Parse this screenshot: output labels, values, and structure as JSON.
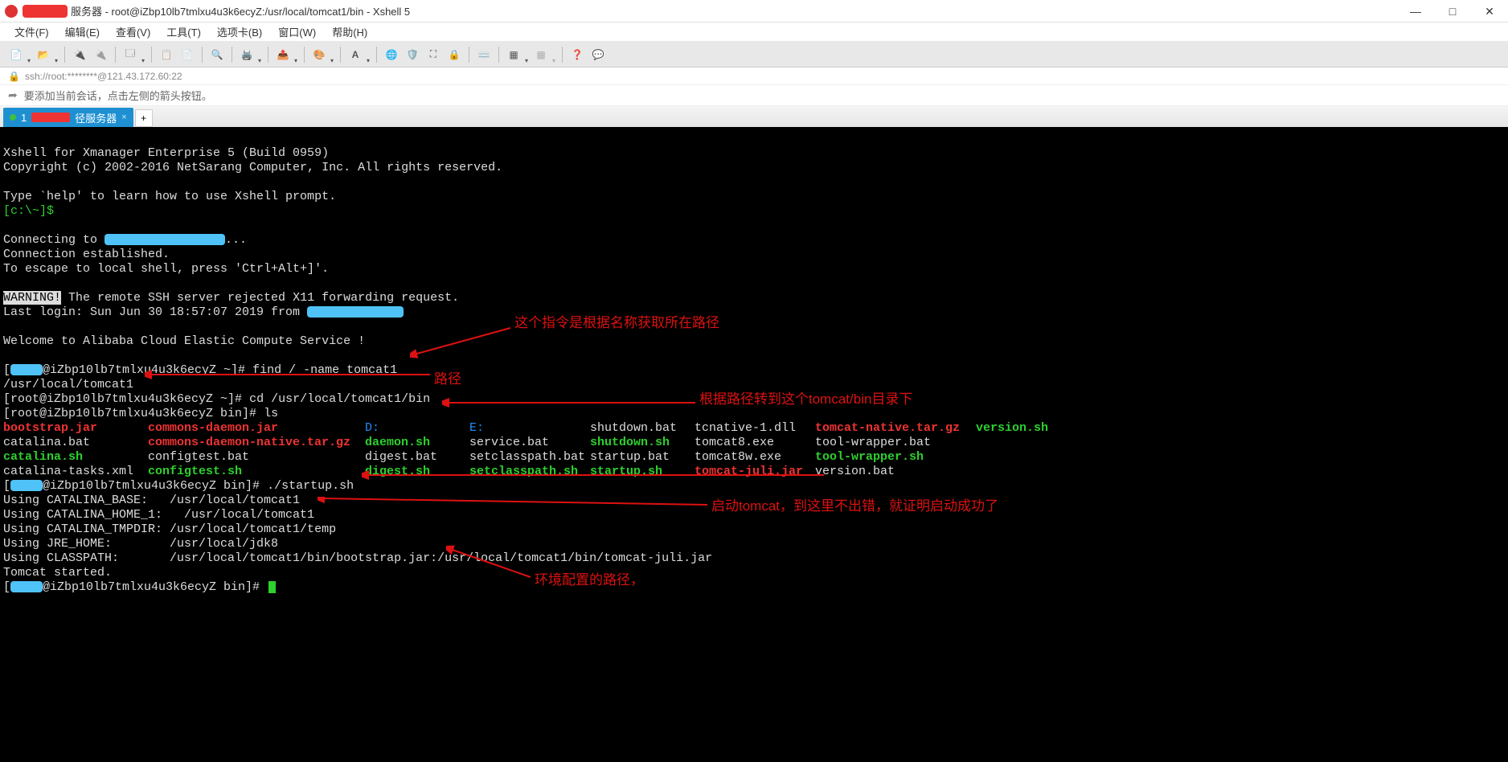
{
  "title": {
    "suffix": "服务器 - root@iZbp10lb7tmlxu4u3k6ecyZ:/usr/local/tomcat1/bin - Xshell 5"
  },
  "window": {
    "minimize": "—",
    "maximize": "□",
    "close": "✕"
  },
  "menu": {
    "file": "文件(F)",
    "edit": "编辑(E)",
    "view": "查看(V)",
    "tools": "工具(T)",
    "tabs": "选项卡(B)",
    "window": "窗口(W)",
    "help": "帮助(H)"
  },
  "address": {
    "url": "ssh://root:********@121.43.172.60:22"
  },
  "hint": {
    "text": "要添加当前会话，点击左侧的箭头按钮。"
  },
  "tab": {
    "num": "1",
    "label": "径服务器",
    "close": "×",
    "new": "+"
  },
  "term": {
    "banner1": "Xshell for Xmanager Enterprise 5 (Build 0959)",
    "banner2": "Copyright (c) 2002-2016 NetSarang Computer, Inc. All rights reserved.",
    "help": "Type `help' to learn how to use Xshell prompt.",
    "prompt0": "[c:\\~]$",
    "conn1a": "Connecting to ",
    "conn1b": "...",
    "conn2": "Connection established.",
    "esc": "To escape to local shell, press 'Ctrl+Alt+]'.",
    "warn": "WARNING!",
    "warn_rest": " The remote SSH server rejected X11 forwarding request.",
    "login_a": "Last login: Sun Jun 30 18:57:07 2019 from ",
    "welcome": "Welcome to Alibaba Cloud Elastic Compute Service !",
    "p1a": "[",
    "p1b": "@iZbp10lb7tmlxu4u3k6ecyZ ~]# ",
    "cmd_find": "find / -name tomcat1",
    "find_out": "/usr/local/tomcat1",
    "p2": "[root@iZbp10lb7tmlxu4u3k6ecyZ ~]# ",
    "cmd_cd": "cd /usr/local/tomcat1/bin",
    "p3": "[root@iZbp10lb7tmlxu4u3k6ecyZ bin]# ",
    "cmd_ls": "ls",
    "ls": {
      "r1": {
        "c1": "bootstrap.jar",
        "c2": "commons-daemon.jar",
        "c3": "D:",
        "c4": "E:",
        "c5": "shutdown.bat",
        "c6": "tcnative-1.dll",
        "c7": "tomcat-native.tar.gz",
        "c8": "version.sh"
      },
      "r2": {
        "c1": "catalina.bat",
        "c2": "commons-daemon-native.tar.gz",
        "c3": "daemon.sh",
        "c4": "service.bat",
        "c5": "shutdown.sh",
        "c6": "tomcat8.exe",
        "c7": "tool-wrapper.bat"
      },
      "r3": {
        "c1": "catalina.sh",
        "c2": "configtest.bat",
        "c3": "digest.bat",
        "c4": "setclasspath.bat",
        "c5": "startup.bat",
        "c6": "tomcat8w.exe",
        "c7": "tool-wrapper.sh"
      },
      "r4": {
        "c1": "catalina-tasks.xml",
        "c2": "configtest.sh",
        "c3": "digest.sh",
        "c4": "setclasspath.sh",
        "c5": "startup.sh",
        "c6": "tomcat-juli.jar",
        "c7": "version.bat"
      }
    },
    "p4a": "[",
    "p4b": "@iZbp10lb7tmlxu4u3k6ecyZ bin]# ",
    "cmd_start": "./startup.sh",
    "u1": "Using CATALINA_BASE:   /usr/local/tomcat1",
    "u2": "Using CATALINA_HOME_1:   /usr/local/tomcat1",
    "u3": "Using CATALINA_TMPDIR: /usr/local/tomcat1/temp",
    "u4": "Using JRE_HOME:        /usr/local/jdk8",
    "u5": "Using CLASSPATH:       /usr/local/tomcat1/bin/bootstrap.jar:/usr/local/tomcat1/bin/tomcat-juli.jar",
    "started": "Tomcat started.",
    "p5a": "[",
    "p5b": "@iZbp10lb7tmlxu4u3k6ecyZ bin]# "
  },
  "annot": {
    "a1": "这个指令是根据名称获取所在路径",
    "a2": "路径",
    "a3": "根据路径转到这个tomcat/bin目录下",
    "a4": "启动tomcat，到这里不出错，就证明启动成功了",
    "a5": "环境配置的路径，"
  }
}
